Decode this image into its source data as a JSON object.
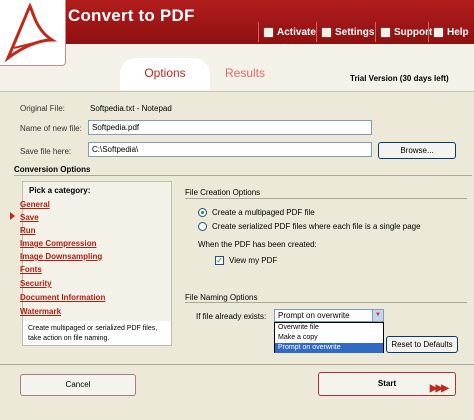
{
  "header": {
    "app_title": "Convert to PDF",
    "toolbar": [
      {
        "label": "Activate",
        "icon": "key-icon"
      },
      {
        "label": "Settings",
        "icon": "settings-icon"
      },
      {
        "label": "Support",
        "icon": "support-icon"
      },
      {
        "label": "Help",
        "icon": "help-icon"
      }
    ]
  },
  "tabs": {
    "options": "Options",
    "results": "Results",
    "trial": "Trial Version (30 days left)"
  },
  "file": {
    "original_label": "Original File:",
    "original_value": "Softpedia.txt - Notepad",
    "name_label": "Name of new file:",
    "name_value": "Softpedia.pdf",
    "save_label": "Save file here:",
    "save_value": "C:\\Softpedia\\",
    "browse": "Browse..."
  },
  "conversion": {
    "title": "Conversion Options",
    "category_head": "Pick a category:",
    "categories": [
      "General",
      "Save",
      "Run",
      "Image Compression",
      "Image Downsampling",
      "Fonts",
      "Security",
      "Document Information",
      "Watermark"
    ],
    "selected_index": 1,
    "description": "Create multipaged or serialized PDF files, take action on file naming."
  },
  "creation": {
    "title": "File Creation Options",
    "opt1": "Create a multipaged PDF file",
    "opt2": "Create serialized PDF files where each file is a single page",
    "when_created": "When the PDF has been created:",
    "view_pdf": "View my PDF",
    "view_checked": true
  },
  "naming": {
    "title": "File Naming Options",
    "exists_label": "If file already exists:",
    "selected": "Prompt on overwrite",
    "options": [
      "Overwrite file",
      "Make a copy",
      "Prompt on overwrite"
    ],
    "reset_button": "Reset to Defaults"
  },
  "actions": {
    "cancel": "Cancel",
    "start": "Start"
  },
  "colors": {
    "brand": "#a01818",
    "link": "#b02010"
  }
}
